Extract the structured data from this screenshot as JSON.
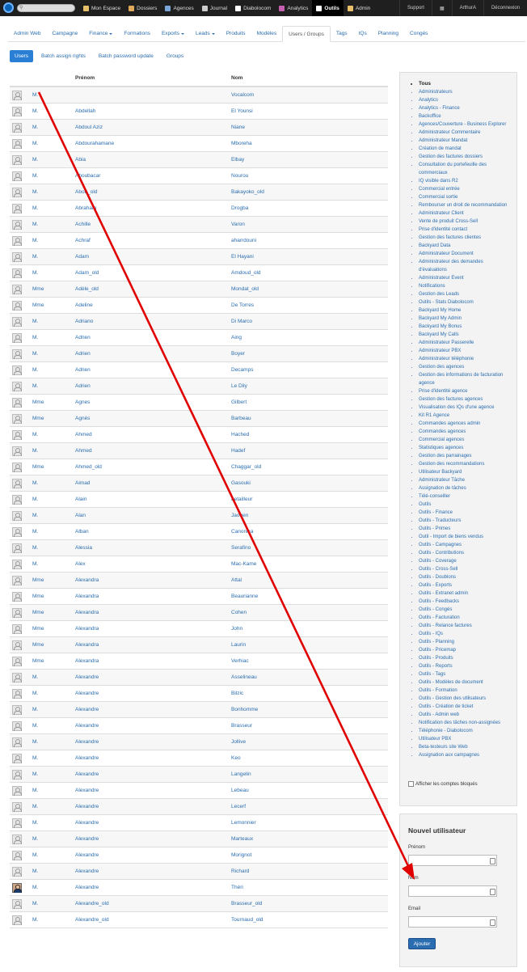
{
  "topbar": {
    "search_placeholder": "",
    "nav": [
      {
        "label": "Mon Espace",
        "icon": "home-icon",
        "color": "#e8c06a"
      },
      {
        "label": "Dossiers",
        "icon": "folder-icon",
        "color": "#e0a85a"
      },
      {
        "label": "Agences",
        "icon": "building-icon",
        "color": "#7aa7d8"
      },
      {
        "label": "Journal",
        "icon": "pen-icon",
        "color": "#cccccc"
      },
      {
        "label": "Diabolocom",
        "icon": "phone-icon",
        "color": "#ffffff"
      },
      {
        "label": "Analytics",
        "icon": "chart-icon",
        "color": "#c55fb0"
      },
      {
        "label": "Outils",
        "icon": "wrench-icon",
        "color": "#ffffff",
        "active": true
      },
      {
        "label": "Admin",
        "icon": "warning-icon",
        "color": "#e8c06a"
      }
    ],
    "right": [
      "Support",
      "▦",
      "ArthurA",
      "Déconnexion"
    ]
  },
  "subnav": [
    {
      "label": "Admin Web"
    },
    {
      "label": "Campagne"
    },
    {
      "label": "Finance",
      "dropdown": true
    },
    {
      "label": "Formations"
    },
    {
      "label": "Exports",
      "dropdown": true
    },
    {
      "label": "Leads",
      "dropdown": true
    },
    {
      "label": "Produits"
    },
    {
      "label": "Modèles"
    },
    {
      "label": "Users / Groups",
      "active": true
    },
    {
      "label": "Tags"
    },
    {
      "label": "IQs"
    },
    {
      "label": "Planning"
    },
    {
      "label": "Congés"
    }
  ],
  "pills": [
    {
      "label": "Users",
      "active": true
    },
    {
      "label": "Batch assign rights"
    },
    {
      "label": "Batch password update"
    },
    {
      "label": "Groups"
    }
  ],
  "table": {
    "headers": {
      "prenom": "Prénom",
      "nom": "Nom"
    },
    "rows": [
      {
        "civ": "M.",
        "prenom": "",
        "nom": "Vocalcom"
      },
      {
        "civ": "M.",
        "prenom": "Abdellah",
        "nom": "El Younsi"
      },
      {
        "civ": "M.",
        "prenom": "Abdoul Aziz",
        "nom": "Niane"
      },
      {
        "civ": "M.",
        "prenom": "Abdourahamane",
        "nom": "Mboreha"
      },
      {
        "civ": "M.",
        "prenom": "Abia",
        "nom": "Elbay"
      },
      {
        "civ": "M.",
        "prenom": "Aboubacar",
        "nom": "Nourou"
      },
      {
        "civ": "M.",
        "prenom": "Abou_old",
        "nom": "Bakayoko_old"
      },
      {
        "civ": "M.",
        "prenom": "Abraham",
        "nom": "Drogba"
      },
      {
        "civ": "M.",
        "prenom": "Achille",
        "nom": "Varon"
      },
      {
        "civ": "M.",
        "prenom": "Achraf",
        "nom": "aharrdouni"
      },
      {
        "civ": "M.",
        "prenom": "Adam",
        "nom": "El Hayani"
      },
      {
        "civ": "M.",
        "prenom": "Adam_old",
        "nom": "Amdoud_old"
      },
      {
        "civ": "Mme",
        "prenom": "Adèle_old",
        "nom": "Mondat_old"
      },
      {
        "civ": "Mme",
        "prenom": "Adeline",
        "nom": "De Torres"
      },
      {
        "civ": "M.",
        "prenom": "Adriano",
        "nom": "Di Marco"
      },
      {
        "civ": "M.",
        "prenom": "Adrien",
        "nom": "Aing"
      },
      {
        "civ": "M.",
        "prenom": "Adrien",
        "nom": "Boyer"
      },
      {
        "civ": "M.",
        "prenom": "Adrien",
        "nom": "Decamps"
      },
      {
        "civ": "M.",
        "prenom": "Adrien",
        "nom": "Le Dily"
      },
      {
        "civ": "Mme",
        "prenom": "Agnes",
        "nom": "Gilbert"
      },
      {
        "civ": "Mme",
        "prenom": "Agnès",
        "nom": "Barbeau"
      },
      {
        "civ": "M.",
        "prenom": "Ahmed",
        "nom": "Hached"
      },
      {
        "civ": "M.",
        "prenom": "Ahmed",
        "nom": "Hadef"
      },
      {
        "civ": "Mme",
        "prenom": "Ahmed_old",
        "nom": "Chaggar_old"
      },
      {
        "civ": "M.",
        "prenom": "Aimad",
        "nom": "Gasouki"
      },
      {
        "civ": "M.",
        "prenom": "Alain",
        "nom": "Letailleur"
      },
      {
        "civ": "M.",
        "prenom": "Alan",
        "nom": "Jaouen"
      },
      {
        "civ": "M.",
        "prenom": "Alban",
        "nom": "Canonica"
      },
      {
        "civ": "M.",
        "prenom": "Alessia",
        "nom": "Serafino"
      },
      {
        "civ": "M.",
        "prenom": "Alex",
        "nom": "Mac-Kame"
      },
      {
        "civ": "Mme",
        "prenom": "Alexandra",
        "nom": "Attal"
      },
      {
        "civ": "Mme",
        "prenom": "Alexandra",
        "nom": "Beaurianne"
      },
      {
        "civ": "Mme",
        "prenom": "Alexandra",
        "nom": "Cohen"
      },
      {
        "civ": "Mme",
        "prenom": "Alexandra",
        "nom": "John"
      },
      {
        "civ": "Mme",
        "prenom": "Alexandra",
        "nom": "Laurin"
      },
      {
        "civ": "Mme",
        "prenom": "Alexandra",
        "nom": "Verhiac"
      },
      {
        "civ": "M.",
        "prenom": "Alexandre",
        "nom": "Asselineau"
      },
      {
        "civ": "M.",
        "prenom": "Alexandre",
        "nom": "Bilzic"
      },
      {
        "civ": "M.",
        "prenom": "Alexandre",
        "nom": "Bonhomme"
      },
      {
        "civ": "M.",
        "prenom": "Alexandre",
        "nom": "Brasseur"
      },
      {
        "civ": "M.",
        "prenom": "Alexandre",
        "nom": "Jollive"
      },
      {
        "civ": "M.",
        "prenom": "Alexandre",
        "nom": "Keo"
      },
      {
        "civ": "M.",
        "prenom": "Alexandre",
        "nom": "Langelin"
      },
      {
        "civ": "M.",
        "prenom": "Alexandre",
        "nom": "Lebeau"
      },
      {
        "civ": "M.",
        "prenom": "Alexandre",
        "nom": "Lecerf"
      },
      {
        "civ": "M.",
        "prenom": "Alexandre",
        "nom": "Lemonnier"
      },
      {
        "civ": "M.",
        "prenom": "Alexandre",
        "nom": "Marteaux"
      },
      {
        "civ": "M.",
        "prenom": "Alexandre",
        "nom": "Morignot"
      },
      {
        "civ": "M.",
        "prenom": "Alexandre",
        "nom": "Richard"
      },
      {
        "civ": "M.",
        "prenom": "Alexandre",
        "nom": "Théri",
        "photo": true
      },
      {
        "civ": "M.",
        "prenom": "Alexandre_old",
        "nom": "Brasseur_old"
      },
      {
        "civ": "M.",
        "prenom": "Alexandre_old",
        "nom": "Tournaud_old"
      }
    ]
  },
  "roles": {
    "items": [
      "Tous",
      "Administrateurs",
      "Analytics",
      "Analytics - Finance",
      "Backoffice",
      "Agences/Couverture - Business Explorer",
      "Administrateur Commentaire",
      "Administrateur Mandat",
      "Création de mandat",
      "Gestion des factures dossiers",
      "Consultation du portefeuille des commerciaux",
      "IQ visible dans R2",
      "Commercial entrée",
      "Commercial sortie",
      "Rembourser un droit de recommandation",
      "Administrateur Client",
      "Vente de produit Cross-Sell",
      "Prise d'identité contact",
      "Gestion des factures clientes",
      "Backyard Data",
      "Administrateur Document",
      "Administrateur des demandes d'évaluations",
      "Administrateur Event",
      "Notifications",
      "Gestion des Leads",
      "Outils - Stats Diabolocom",
      "Backyard My Home",
      "Backyard My Admin",
      "Backyard My Bonus",
      "Backyard My Calls",
      "Administrateur Passerelle",
      "Administrateur PBX",
      "Administrateur téléphonie",
      "Gestion des agences",
      "Gestion des informations de facturation agence",
      "Prise d'identité agence",
      "Gestion des factures agences",
      "Visualisation des IQs d'une agence",
      "Kit R1 Agence",
      "Commandes agences admin",
      "Commandes agences",
      "Commercial agences",
      "Statistiques agences",
      "Gestion des parrainages",
      "Gestion des recommandations",
      "Utilisateur Backyard",
      "Administrateur Tâche",
      "Assignation de tâches",
      "Télé-conseiller",
      "Outils",
      "Outils - Finance",
      "Outils - Traducteurs",
      "Outils - Primes",
      "Outil - Import de biens vendus",
      "Outils - Campagnes",
      "Outils - Contributions",
      "Outils - Coverage",
      "Outils - Cross-Sell",
      "Outils - Doublons",
      "Outils - Exports",
      "Outils - Extranet admin",
      "Outils - Feedbacks",
      "Outils - Congés",
      "Outils - Facturation",
      "Outils - Relance factures",
      "Outils - IQs",
      "Outils - Planning",
      "Outils - Pricemap",
      "Outils - Produits",
      "Outils - Reports",
      "Outils - Tags",
      "Outils - Modèles de document",
      "Outils - Formation",
      "Outils - Gestion des utilisateurs",
      "Outils - Création de ticket",
      "Outils - Admin web",
      "Notification des tâches non-assignées",
      "Téléphonie - Diabolocom",
      "Utilisateur PBX",
      "Beta-testeurs site Web",
      "Assignation aux campagnes"
    ],
    "show_blocked_label": "Afficher les comptes bloqués"
  },
  "new_user": {
    "title": "Nouvel utilisateur",
    "prenom_label": "Prénom",
    "nom_label": "Nom",
    "email_label": "Email",
    "submit_label": "Ajouter"
  },
  "annotation": {
    "color": "#e00000"
  }
}
